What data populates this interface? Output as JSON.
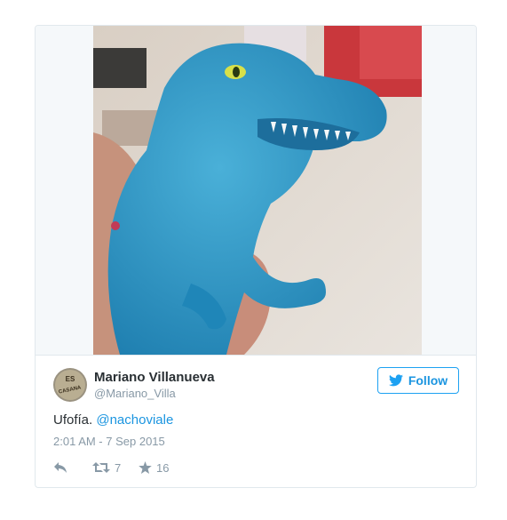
{
  "tweet": {
    "author_name": "Mariano Villanueva",
    "author_handle": "@Mariano_Villa",
    "avatar_text_top": "ES",
    "avatar_text_bottom": "CASANA",
    "follow_label": "Follow",
    "text": "Ufofía.",
    "mention": "@nachoviale",
    "timestamp": "2:01 AM - 7 Sep 2015",
    "retweets": "7",
    "likes": "16"
  },
  "icons": {
    "follow": "twitter-bird-icon",
    "reply": "reply-icon",
    "retweet": "retweet-icon",
    "like": "star-icon"
  },
  "colors": {
    "accent": "#1da1f2",
    "link": "#1b95e0",
    "muted": "#8899a6",
    "text": "#292f33",
    "border": "#e1e8ed"
  }
}
